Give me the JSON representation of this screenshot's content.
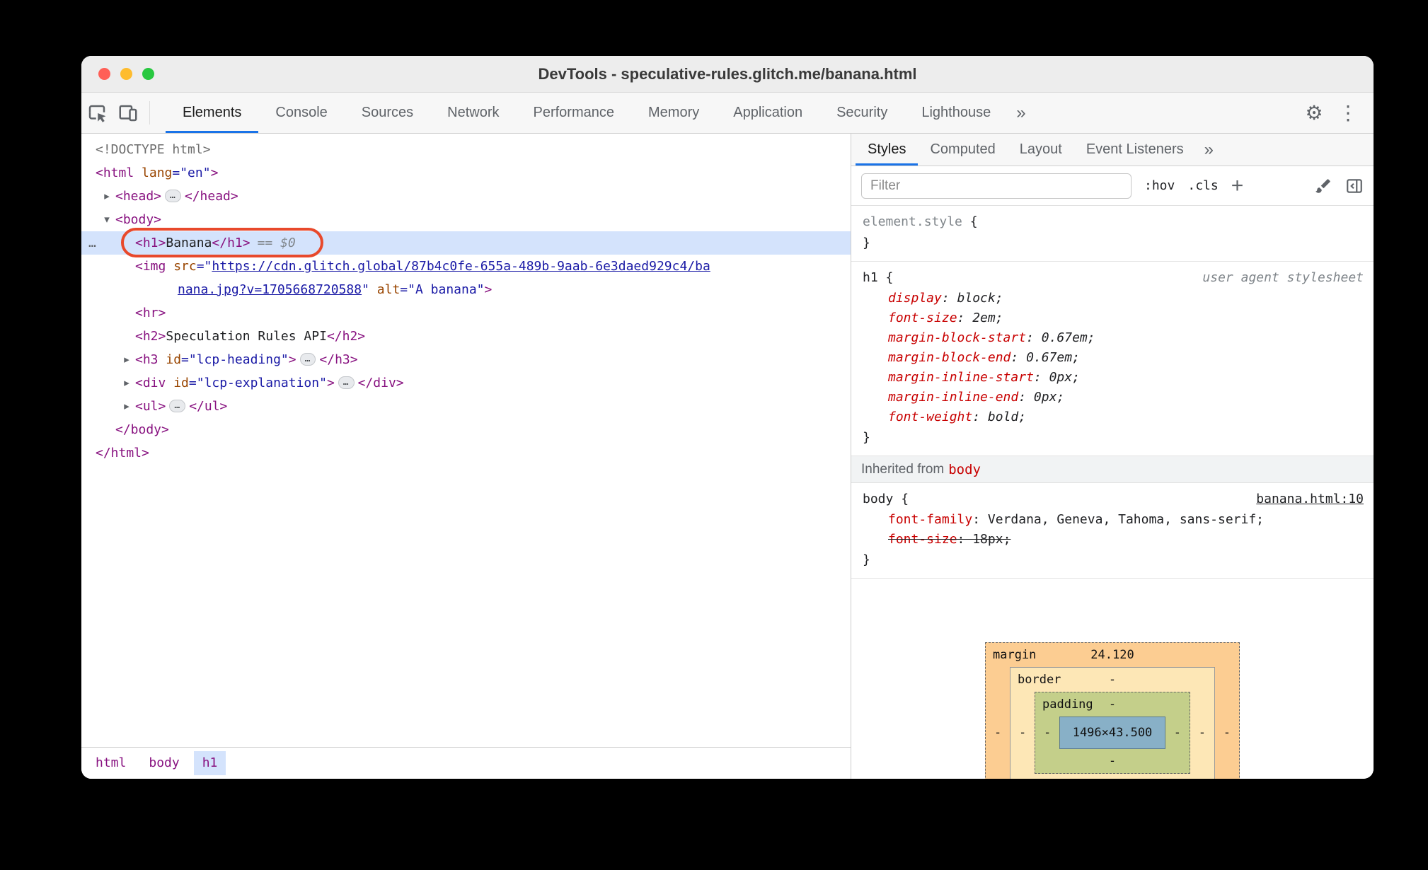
{
  "window": {
    "title": "DevTools - speculative-rules.glitch.me/banana.html"
  },
  "toolbar": {
    "tabs": [
      "Elements",
      "Console",
      "Sources",
      "Network",
      "Performance",
      "Memory",
      "Application",
      "Security",
      "Lighthouse"
    ],
    "active_tab": "Elements",
    "overflow_chevron": "»",
    "gear": "⚙",
    "kebab": "⋮"
  },
  "elements_panel": {
    "pill_char": "…",
    "gutter_ellipsis": "…",
    "tree": [
      {
        "indent": 0,
        "tokens": [
          {
            "t": "doctype",
            "s": "<!DOCTYPE html>"
          }
        ]
      },
      {
        "indent": 0,
        "tokens": [
          {
            "t": "tag",
            "s": "<html"
          },
          {
            "t": "attr",
            "s": " lang"
          },
          {
            "t": "val",
            "s": "=\"en\""
          },
          {
            "t": "tag",
            "s": ">"
          }
        ]
      },
      {
        "indent": 1,
        "arrow": "right",
        "tokens": [
          {
            "t": "tag",
            "s": "<head>"
          },
          {
            "t": "pill"
          },
          {
            "t": "tag",
            "s": "</head>"
          }
        ]
      },
      {
        "indent": 1,
        "arrow": "down",
        "tokens": [
          {
            "t": "tag",
            "s": "<body>"
          }
        ]
      },
      {
        "indent": 2,
        "selected": true,
        "tokens": [
          {
            "t": "tag",
            "s": "<h1>"
          },
          {
            "t": "text",
            "s": "Banana"
          },
          {
            "t": "tag",
            "s": "</h1>"
          },
          {
            "t": "eq",
            "s": "== $0"
          }
        ]
      },
      {
        "indent": 2,
        "tokens": [
          {
            "t": "tag",
            "s": "<img"
          },
          {
            "t": "attr",
            "s": " src"
          },
          {
            "t": "val",
            "s": "=\""
          },
          {
            "t": "link",
            "s": "https://cdn.glitch.global/87b4c0fe-655a-489b-9aab-6e3daed929c4/ba"
          }
        ]
      },
      {
        "indent": 2,
        "cont": true,
        "tokens": [
          {
            "t": "link",
            "s": "nana.jpg?v=1705668720588"
          },
          {
            "t": "val",
            "s": "\""
          },
          {
            "t": "attr",
            "s": " alt"
          },
          {
            "t": "val",
            "s": "=\"A banana\""
          },
          {
            "t": "tag",
            "s": ">"
          }
        ]
      },
      {
        "indent": 2,
        "tokens": [
          {
            "t": "tag",
            "s": "<hr>"
          }
        ]
      },
      {
        "indent": 2,
        "tokens": [
          {
            "t": "tag",
            "s": "<h2>"
          },
          {
            "t": "text",
            "s": "Speculation Rules API"
          },
          {
            "t": "tag",
            "s": "</h2>"
          }
        ]
      },
      {
        "indent": 2,
        "arrow": "right",
        "tokens": [
          {
            "t": "tag",
            "s": "<h3"
          },
          {
            "t": "attr",
            "s": " id"
          },
          {
            "t": "val",
            "s": "=\"lcp-heading\""
          },
          {
            "t": "tag",
            "s": ">"
          },
          {
            "t": "pill"
          },
          {
            "t": "tag",
            "s": "</h3>"
          }
        ]
      },
      {
        "indent": 2,
        "arrow": "right",
        "tokens": [
          {
            "t": "tag",
            "s": "<div"
          },
          {
            "t": "attr",
            "s": " id"
          },
          {
            "t": "val",
            "s": "=\"lcp-explanation\""
          },
          {
            "t": "tag",
            "s": ">"
          },
          {
            "t": "pill"
          },
          {
            "t": "tag",
            "s": "</div>"
          }
        ]
      },
      {
        "indent": 2,
        "arrow": "right",
        "tokens": [
          {
            "t": "tag",
            "s": "<ul>"
          },
          {
            "t": "pill"
          },
          {
            "t": "tag",
            "s": "</ul>"
          }
        ]
      },
      {
        "indent": 1,
        "tokens": [
          {
            "t": "tag",
            "s": "</body>"
          }
        ]
      },
      {
        "indent": 0,
        "tokens": [
          {
            "t": "tag",
            "s": "</html>"
          }
        ]
      }
    ],
    "breadcrumbs": [
      {
        "label": "html",
        "active": false
      },
      {
        "label": "body",
        "active": false
      },
      {
        "label": "h1",
        "active": true
      }
    ]
  },
  "styles_panel": {
    "tabs": [
      "Styles",
      "Computed",
      "Layout",
      "Event Listeners"
    ],
    "active_tab": "Styles",
    "overflow_chevron": "»",
    "filter_placeholder": "Filter",
    "hov_label": ":hov",
    "cls_label": ".cls",
    "plus_label": "+",
    "punct": {
      "open": "{",
      "close": "}",
      "colon": ": ",
      "semi": ";"
    },
    "sections": [
      {
        "kind": "rule",
        "selector": "element.style",
        "selector_gray": true,
        "props": []
      },
      {
        "kind": "rule",
        "selector": "h1",
        "italic": true,
        "origin": "user agent stylesheet",
        "props": [
          {
            "name": "display",
            "value": "block"
          },
          {
            "name": "font-size",
            "value": "2em"
          },
          {
            "name": "margin-block-start",
            "value": "0.67em"
          },
          {
            "name": "margin-block-end",
            "value": "0.67em"
          },
          {
            "name": "margin-inline-start",
            "value": "0px"
          },
          {
            "name": "margin-inline-end",
            "value": "0px"
          },
          {
            "name": "font-weight",
            "value": "bold"
          }
        ]
      },
      {
        "kind": "inherited",
        "prefix": "Inherited from",
        "link": "body"
      },
      {
        "kind": "rule",
        "selector": "body",
        "origin_link": "banana.html:10",
        "props": [
          {
            "name": "font-family",
            "value": "Verdana, Geneva, Tahoma, sans-serif"
          },
          {
            "name": "font-size",
            "value": "18px",
            "struck": true
          }
        ]
      }
    ]
  },
  "box_model": {
    "margin_label": "margin",
    "border_label": "border",
    "padding_label": "padding",
    "margin_top": "24.120",
    "dash": "-",
    "content": "1496×43.500"
  }
}
